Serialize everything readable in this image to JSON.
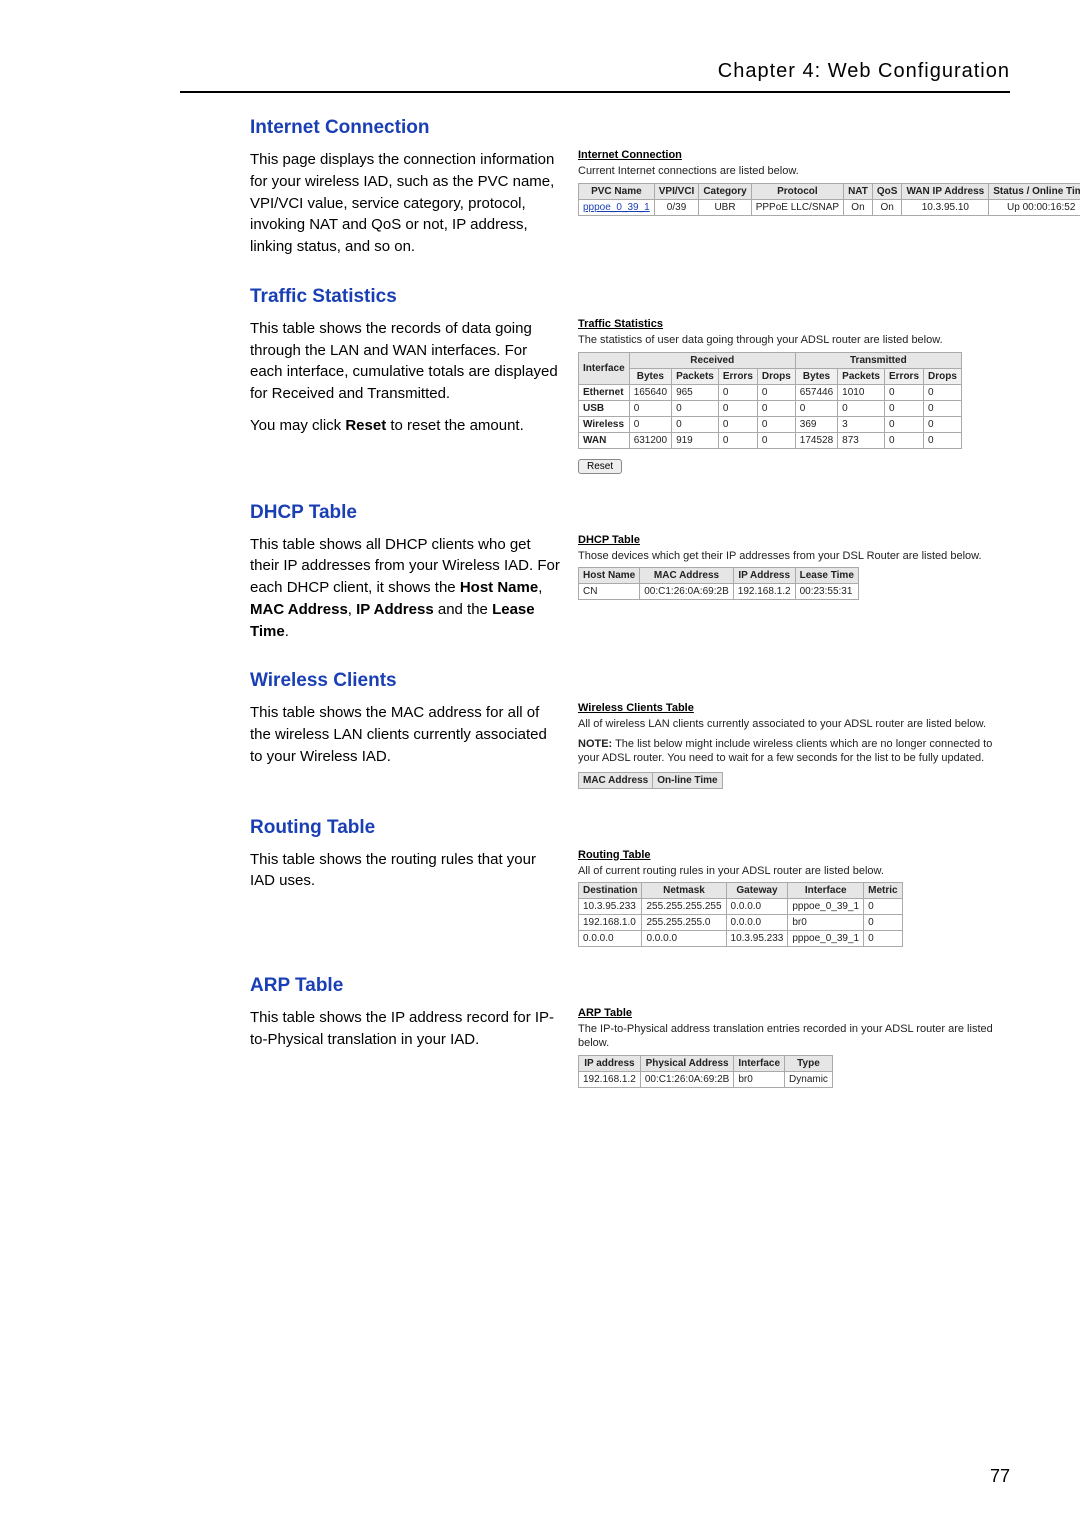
{
  "chapter_header": "Chapter 4: Web Configuration",
  "page_number": "77",
  "sections": {
    "internet": {
      "heading": "Internet Connection",
      "desc": "This page displays the connection information for your wireless IAD, such as the PVC name, VPI/VCI value, service category, protocol, invoking NAT and QoS or not, IP address, linking status, and so on.",
      "shot_title": "Internet Connection",
      "shot_caption": "Current Internet connections are listed below.",
      "headers": [
        "PVC Name",
        "VPI/VCI",
        "Category",
        "Protocol",
        "NAT",
        "QoS",
        "WAN IP Address",
        "Status / Online Time"
      ],
      "row": [
        "pppoe_0_39_1",
        "0/39",
        "UBR",
        "PPPoE LLC/SNAP",
        "On",
        "On",
        "10.3.95.10",
        "Up 00:00:16:52"
      ]
    },
    "traffic": {
      "heading": "Traffic Statistics",
      "desc1": "This table shows the records of data going through the LAN and WAN interfaces. For each interface, cumulative totals are displayed for Received and Transmitted.",
      "desc_bold1": "Received",
      "desc_and": " and ",
      "desc_bold2": "Transmitted",
      "desc_end": ".",
      "desc2a": "You may click ",
      "desc2_bold": "Reset",
      "desc2b": " to reset the amount.",
      "shot_title": "Traffic Statistics",
      "shot_caption": "The statistics of user data going through your ADSL router are listed below.",
      "group_headers": [
        "Interface",
        "Received",
        "Transmitted"
      ],
      "sub_headers": [
        "Bytes",
        "Packets",
        "Errors",
        "Drops",
        "Bytes",
        "Packets",
        "Errors",
        "Drops"
      ],
      "rows": [
        [
          "Ethernet",
          "165640",
          "965",
          "0",
          "0",
          "657446",
          "1010",
          "0",
          "0"
        ],
        [
          "USB",
          "0",
          "0",
          "0",
          "0",
          "0",
          "0",
          "0",
          "0"
        ],
        [
          "Wireless",
          "0",
          "0",
          "0",
          "0",
          "369",
          "3",
          "0",
          "0"
        ],
        [
          "WAN",
          "631200",
          "919",
          "0",
          "0",
          "174528",
          "873",
          "0",
          "0"
        ]
      ],
      "reset_label": "Reset"
    },
    "dhcp": {
      "heading": "DHCP Table",
      "desc_pre": "This table shows all DHCP clients who get their IP addresses from your Wireless IAD. For each DHCP client, it shows the ",
      "b1": "Host Name",
      "c1": ", ",
      "b2": "MAC Address",
      "c2": ", ",
      "b3": "IP Address",
      "c3": " and the ",
      "b4": "Lease Time",
      "c4": ".",
      "shot_title": "DHCP Table",
      "shot_caption": "Those devices which get their IP addresses from your DSL Router are listed below.",
      "headers": [
        "Host Name",
        "MAC Address",
        "IP Address",
        "Lease Time"
      ],
      "row": [
        "CN",
        "00:C1:26:0A:69:2B",
        "192.168.1.2",
        "00:23:55:31"
      ]
    },
    "wireless": {
      "heading": "Wireless Clients",
      "desc": "This table shows the MAC address for all of the wireless LAN clients currently associated to your Wireless IAD.",
      "shot_title": "Wireless Clients Table",
      "shot_caption": "All of wireless LAN clients currently associated to your ADSL router are listed below.",
      "note_label": "NOTE:",
      "note_text": " The list below might include wireless clients which are no longer connected to your ADSL router. You need to wait for a few seconds for the list to be fully updated.",
      "headers": [
        "MAC Address",
        "On-line Time"
      ]
    },
    "routing": {
      "heading": "Routing Table",
      "desc": "This table shows the routing rules that your IAD uses.",
      "shot_title": "Routing Table",
      "shot_caption": "All of current routing rules in your ADSL router are listed below.",
      "headers": [
        "Destination",
        "Netmask",
        "Gateway",
        "Interface",
        "Metric"
      ],
      "rows": [
        [
          "10.3.95.233",
          "255.255.255.255",
          "0.0.0.0",
          "pppoe_0_39_1",
          "0"
        ],
        [
          "192.168.1.0",
          "255.255.255.0",
          "0.0.0.0",
          "br0",
          "0"
        ],
        [
          "0.0.0.0",
          "0.0.0.0",
          "10.3.95.233",
          "pppoe_0_39_1",
          "0"
        ]
      ]
    },
    "arp": {
      "heading": "ARP Table",
      "desc": "This table shows the IP address record for IP-to-Physical translation in your IAD.",
      "shot_title": "ARP Table",
      "shot_caption": "The IP-to-Physical address translation entries recorded in your ADSL router are listed below.",
      "headers": [
        "IP address",
        "Physical Address",
        "Interface",
        "Type"
      ],
      "row": [
        "192.168.1.2",
        "00:C1:26:0A:69:2B",
        "br0",
        "Dynamic"
      ]
    }
  }
}
